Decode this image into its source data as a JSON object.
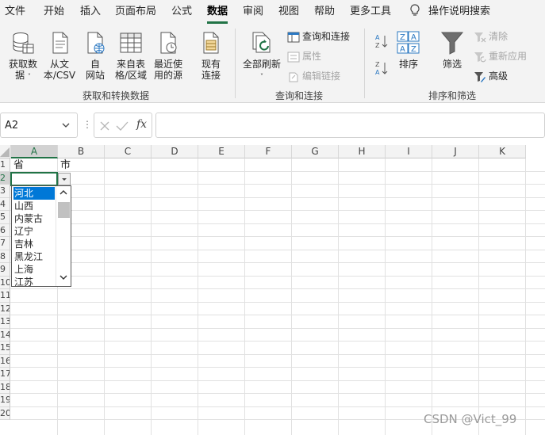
{
  "menu": {
    "tabs": [
      "文件",
      "开始",
      "插入",
      "页面布局",
      "公式",
      "数据",
      "审阅",
      "视图",
      "帮助",
      "更多工具"
    ],
    "active_tab": "数据",
    "search_label": "操作说明搜索"
  },
  "ribbon": {
    "get_transform": {
      "get_data_line1": "获取数",
      "get_data_line2": "据",
      "from_text_line1": "从文",
      "from_text_line2": "本/CSV",
      "from_web_line1": "自",
      "from_web_line2": "网站",
      "from_table_line1": "来自表",
      "from_table_line2": "格/区域",
      "recent_line1": "最近使",
      "recent_line2": "用的源",
      "existing_line1": "现有",
      "existing_line2": "连接",
      "group_label": "获取和转换数据"
    },
    "queries": {
      "refresh_all": "全部刷新",
      "queries_connections": "查询和连接",
      "properties": "属性",
      "edit_links": "编辑链接",
      "group_label": "查询和连接"
    },
    "sort_filter": {
      "sort": "排序",
      "filter": "筛选",
      "clear": "清除",
      "reapply": "重新应用",
      "advanced": "高级",
      "group_label": "排序和筛选"
    }
  },
  "formula_bar": {
    "name_box": "A2",
    "fx": "fx",
    "formula": ""
  },
  "sheet": {
    "columns": [
      "A",
      "B",
      "C",
      "D",
      "E",
      "F",
      "G",
      "H",
      "I",
      "J",
      "K"
    ],
    "selected_column": "A",
    "rows": [
      "1",
      "2",
      "3",
      "4",
      "5",
      "6",
      "7",
      "8",
      "9",
      "10",
      "11",
      "12",
      "13",
      "14",
      "15",
      "16",
      "17",
      "18",
      "19",
      "20"
    ],
    "selected_row": "2",
    "cells": {
      "A1": "省",
      "B1": "市"
    }
  },
  "dropdown": {
    "items": [
      "河北",
      "山西",
      "内蒙古",
      "辽宁",
      "吉林",
      "黑龙江",
      "上海",
      "江苏"
    ],
    "selected": "河北"
  },
  "colors": {
    "accent": "#217346",
    "selection": "#0078d7"
  },
  "watermark": "CSDN @Vict_99"
}
